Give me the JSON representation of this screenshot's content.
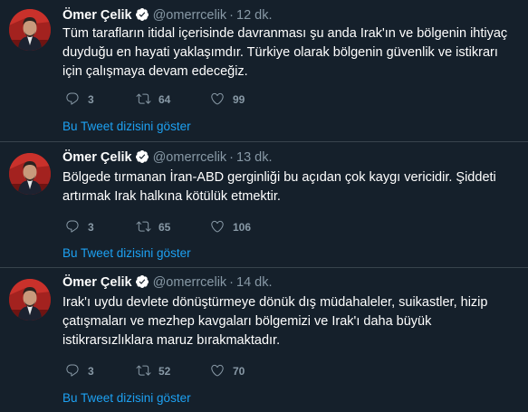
{
  "colors": {
    "background": "#15202b",
    "divider": "#38444d",
    "muted": "#8899a6",
    "link": "#1da1f2",
    "verified_badge": "#ffffff"
  },
  "tweets": [
    {
      "author_name": "Ömer Çelik",
      "handle": "@omerrcelik",
      "separator": "·",
      "time": "12 dk.",
      "text": "Tüm tarafların itidal içerisinde davranması şu anda Irak'ın ve bölgenin ihtiyaç duyduğu en hayati yaklaşımdır. Türkiye olarak bölgenin güvenlik ve istikrarı için çalışmaya devam edeceğiz.",
      "replies": "3",
      "retweets": "64",
      "likes": "99",
      "thread_link": "Bu Tweet dizisini göster",
      "icons": [
        "avatar",
        "verified-badge-icon",
        "reply-icon",
        "retweet-icon",
        "like-icon"
      ]
    },
    {
      "author_name": "Ömer Çelik",
      "handle": "@omerrcelik",
      "separator": "·",
      "time": "13 dk.",
      "text": "Bölgede tırmanan İran-ABD gerginliği bu açıdan çok kaygı vericidir. Şiddeti artırmak Irak halkına kötülük etmektir.",
      "replies": "3",
      "retweets": "65",
      "likes": "106",
      "thread_link": "Bu Tweet dizisini göster",
      "icons": [
        "avatar",
        "verified-badge-icon",
        "reply-icon",
        "retweet-icon",
        "like-icon"
      ]
    },
    {
      "author_name": "Ömer Çelik",
      "handle": "@omerrcelik",
      "separator": "·",
      "time": "14 dk.",
      "text": "Irak'ı uydu devlete dönüştürmeye dönük dış müdahaleler, suikastler, hizip çatışmaları ve mezhep kavgaları bölgemizi ve Irak'ı daha büyük istikrarsızlıklara maruz bırakmaktadır.",
      "replies": "3",
      "retweets": "52",
      "likes": "70",
      "thread_link": "Bu Tweet dizisini göster",
      "icons": [
        "avatar",
        "verified-badge-icon",
        "reply-icon",
        "retweet-icon",
        "like-icon"
      ]
    }
  ]
}
